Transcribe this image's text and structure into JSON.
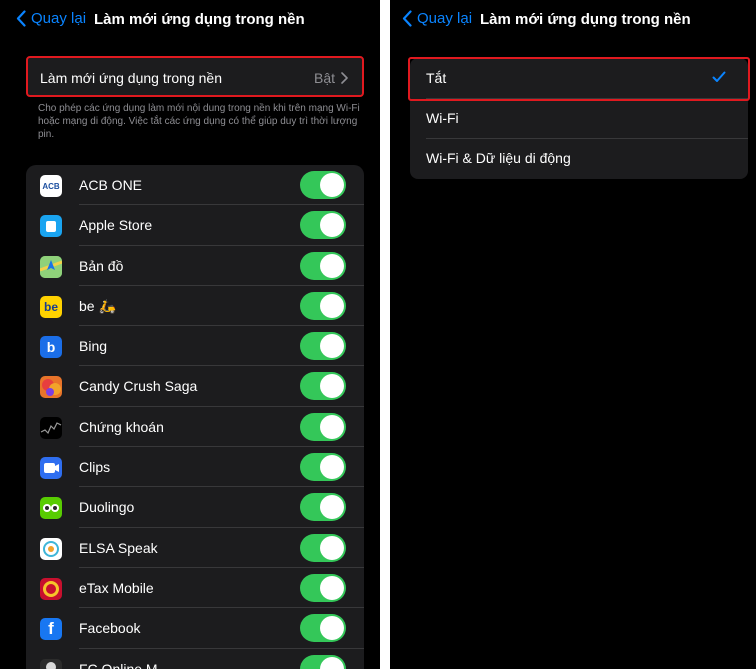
{
  "left": {
    "nav": {
      "back_label": "Quay lại",
      "title": "Làm mới ứng dụng trong nền"
    },
    "header": {
      "label": "Làm mới ứng dụng trong nền",
      "value": "Bật"
    },
    "footnote": "Cho phép các ứng dụng làm mới nội dung trong nền khi trên mạng Wi-Fi hoặc mạng di động. Việc tắt các ứng dụng có thể giúp duy trì thời lượng pin.",
    "apps": [
      {
        "name": "ACB ONE",
        "icon": "acb-one-icon",
        "icon_text": "ACB",
        "color": "#ffffff",
        "enabled": true
      },
      {
        "name": "Apple Store",
        "icon": "apple-store-icon",
        "icon_text": "",
        "color": "#1aa4f0",
        "enabled": true
      },
      {
        "name": "Bản đồ",
        "icon": "maps-icon",
        "icon_text": "",
        "color": "#5ab65c",
        "enabled": true
      },
      {
        "name": "be 🛵",
        "icon": "be-icon",
        "icon_text": "be",
        "color": "#ffd200",
        "enabled": true
      },
      {
        "name": "Bing",
        "icon": "bing-icon",
        "icon_text": "b",
        "color": "#1b6ee8",
        "enabled": true
      },
      {
        "name": "Candy Crush Saga",
        "icon": "candy-crush-icon",
        "icon_text": "",
        "color": "#e8742a",
        "enabled": true
      },
      {
        "name": "Chứng khoán",
        "icon": "stocks-icon",
        "icon_text": "",
        "color": "#000000",
        "enabled": true
      },
      {
        "name": "Clips",
        "icon": "clips-icon",
        "icon_text": "",
        "color": "#2f6ef0",
        "enabled": true
      },
      {
        "name": "Duolingo",
        "icon": "duolingo-icon",
        "icon_text": "",
        "color": "#58cc02",
        "enabled": true
      },
      {
        "name": "ELSA Speak",
        "icon": "elsa-speak-icon",
        "icon_text": "",
        "color": "#ffffff",
        "enabled": true
      },
      {
        "name": "eTax Mobile",
        "icon": "etax-mobile-icon",
        "icon_text": "",
        "color": "#c8102e",
        "enabled": true
      },
      {
        "name": "Facebook",
        "icon": "facebook-icon",
        "icon_text": "f",
        "color": "#1877f2",
        "enabled": true
      },
      {
        "name": "FC Online M",
        "icon": "fc-online-icon",
        "icon_text": "",
        "color": "#2c2c2c",
        "enabled": true
      }
    ]
  },
  "right": {
    "nav": {
      "back_label": "Quay lại",
      "title": "Làm mới ứng dụng trong nền"
    },
    "options": [
      {
        "label": "Tắt",
        "selected": true
      },
      {
        "label": "Wi-Fi",
        "selected": false
      },
      {
        "label": "Wi-Fi & Dữ liệu di động",
        "selected": false
      }
    ]
  },
  "colors": {
    "accent": "#0a84ff",
    "toggle_on": "#34c759",
    "highlight": "#e0191f",
    "cell_bg": "#1c1c1e",
    "secondary_text": "#8e8e93"
  }
}
